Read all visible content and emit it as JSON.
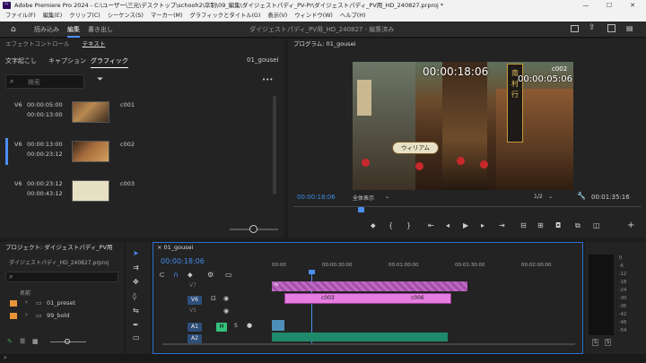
{
  "window": {
    "title": "Adobe Premiere Pro 2024 - C:\\ユーザー\\三元\\デスクトップ\\schooh2\\卒制\\09_編集\\ダイジェストパディ_PV-Pr\\ダイジェストパディ_PV用_HD_240827.prproj *",
    "app_badge": "Pr",
    "min": "—",
    "max": "☐",
    "close": "✕"
  },
  "menu": [
    "ファイル(F)",
    "編集(E)",
    "クリップ(C)",
    "シーケンス(S)",
    "マーカー(M)",
    "グラフィックとタイトル(G)",
    "表示(V)",
    "ウィンドウ(W)",
    "ヘルプ(H)"
  ],
  "workspace": {
    "tabs": [
      "読み込み",
      "編集",
      "書き出し"
    ],
    "active": "編集",
    "project_title": "ダイジェストパディ_PV用_HD_240827 - 編集済み"
  },
  "left_panel": {
    "tabs": [
      "エフェクトコントロール",
      "テキスト"
    ],
    "subtabs": [
      "文字起こし",
      "キャプション",
      "グラフィック"
    ],
    "active_subtab": "グラフィック",
    "sequence": "01_gousei",
    "search_placeholder": "検索",
    "more": "•••",
    "items": [
      {
        "track": "V6",
        "in": "00:00:05:00",
        "out": "00:00:13:00",
        "name": "c001"
      },
      {
        "track": "V6",
        "in": "00:00:13:00",
        "out": "00:00:23:12",
        "name": "c002"
      },
      {
        "track": "V6",
        "in": "00:00:23:12",
        "out": "00:00:43:12",
        "name": "c003"
      }
    ]
  },
  "program": {
    "title": "プログラム: 01_gousei",
    "overlay_tc1": "00:00:18:06",
    "overlay_tc2": "00:00:05:06",
    "overlay_small": "c002",
    "current_tc": "00:00:18:06",
    "fit": "全体表示",
    "resolution": "1/2",
    "duration": "00:01:35:16",
    "sign_text": "ウィリアム",
    "banner_text": "南 村 行"
  },
  "project_panel": {
    "title": "プロジェクト: ダイジェストパディ_PV用",
    "file": "ダイジェストパディ_HD_240827.prproj",
    "col_name": "名前",
    "bins": [
      "01_preset",
      "99_bold"
    ]
  },
  "timeline": {
    "tab": "01_gousei",
    "current_tc": "00:00:18:06",
    "ruler": [
      "00:00",
      "00:00:30:00",
      "00:01:00:00",
      "00:01:30:00",
      "00:02:00:00"
    ],
    "tracks": [
      "V7",
      "V6",
      "V5",
      "A1",
      "A2"
    ],
    "clips": [
      "c003",
      "c006"
    ],
    "mute": "M",
    "solo": "S",
    "fx_label": "fx"
  },
  "meters": {
    "scale": [
      "0",
      "-6",
      "-12",
      "-18",
      "-24",
      "-30",
      "-36",
      "-42",
      "-48",
      "-54"
    ],
    "solo": [
      "S",
      "S"
    ]
  },
  "colors": {
    "accent": "#4b8ff5",
    "graphic_clip": "#e57ee0",
    "audio_clip": "#1f8a6b",
    "tc_blue": "#3e8de6"
  }
}
